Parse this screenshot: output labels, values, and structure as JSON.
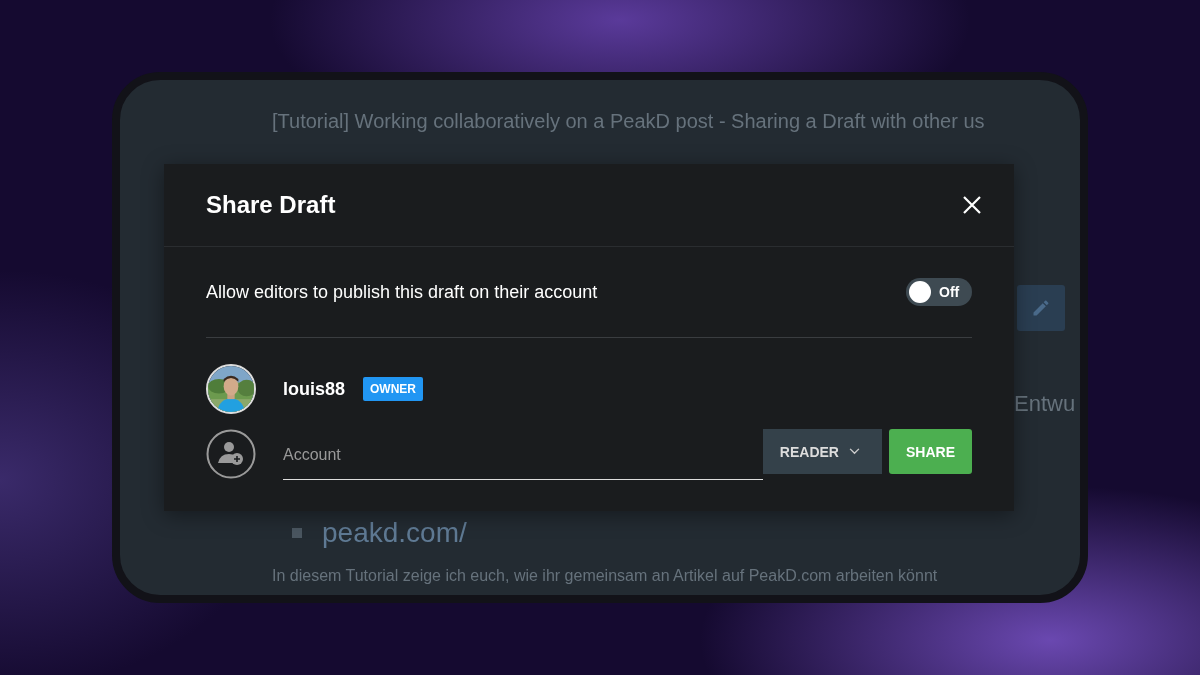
{
  "background_page": {
    "title": "[Tutorial] Working collaboratively on a PeakD post - Sharing a Draft with other us",
    "heading_fragment": "Entwu",
    "link": "peakd.com/",
    "intro": "In diesem Tutorial zeige ich euch, wie ihr gemeinsam an Artikel auf PeakD.com arbeiten könnt"
  },
  "dialog": {
    "title": "Share Draft",
    "publish_toggle": {
      "label": "Allow editors to publish this draft on their account",
      "on": false,
      "state_label": "Off"
    },
    "members": [
      {
        "name": "louis88",
        "role": "OWNER"
      }
    ],
    "invite": {
      "placeholder": "Account",
      "permission": "READER",
      "share_button": "SHARE"
    }
  }
}
